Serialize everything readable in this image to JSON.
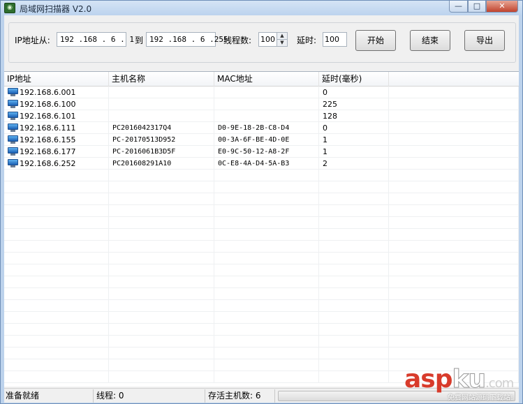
{
  "window": {
    "title": "局域网扫描器 V2.0",
    "min_glyph": "—",
    "max_glyph": "□",
    "close_glyph": "✕"
  },
  "toolbar": {
    "ip_from_label": "IP地址从:",
    "ip_from_value": "192 .168 . 6  . 1",
    "to_label": "到",
    "ip_to_value": "192 .168 . 6  .255",
    "threads_label": "线程数:",
    "threads_value": "100",
    "delay_label": "延时:",
    "delay_value": "100",
    "start_label": "开始",
    "stop_label": "结束",
    "export_label": "导出"
  },
  "table": {
    "columns": [
      "IP地址",
      "主机名称",
      "MAC地址",
      "延时(毫秒)"
    ],
    "rows": [
      {
        "ip": "192.168.6.001",
        "host": "",
        "mac": "",
        "delay": "0"
      },
      {
        "ip": "192.168.6.100",
        "host": "",
        "mac": "",
        "delay": "225"
      },
      {
        "ip": "192.168.6.101",
        "host": "",
        "mac": "",
        "delay": "128"
      },
      {
        "ip": "192.168.6.111",
        "host": "PC2016042317Q4",
        "mac": "D0-9E-18-2B-C8-D4",
        "delay": "0"
      },
      {
        "ip": "192.168.6.155",
        "host": "PC-20170513D952",
        "mac": "00-3A-6F-BE-4D-0E",
        "delay": "1"
      },
      {
        "ip": "192.168.6.177",
        "host": "PC-2016061B3D5F",
        "mac": "E0-9C-50-12-A8-2F",
        "delay": "1"
      },
      {
        "ip": "192.168.6.252",
        "host": "PC201608291A10",
        "mac": "0C-E8-4A-D4-5A-B3",
        "delay": "2"
      }
    ],
    "empty_rows": 18
  },
  "status": {
    "ready": "准备就绪",
    "threads": "线程:  0",
    "alive_hosts": "存活主机数: 6"
  },
  "watermark": {
    "brand_a": "asp",
    "brand_b": "ku",
    "brand_c": ".com",
    "tagline": "免费网站源码下载站!"
  },
  "colors": {
    "watermark_red": "#d83b2b",
    "titlebar": "#bcd3ee"
  }
}
